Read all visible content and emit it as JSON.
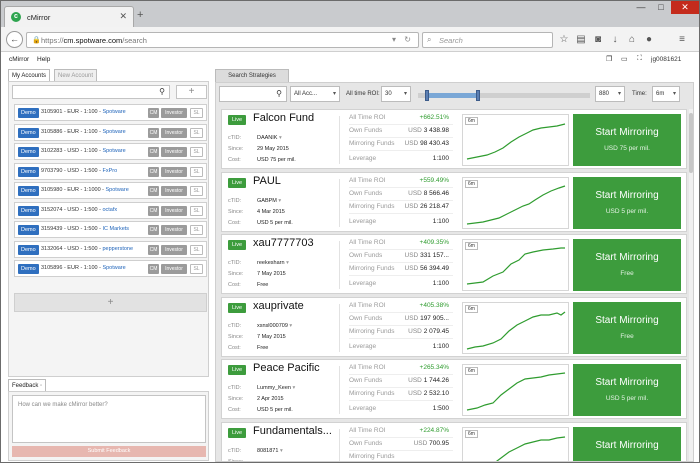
{
  "browser": {
    "tab_title": "cMirror",
    "url_scheme": "https://",
    "url_host": "cm.spotware.com",
    "url_path": "/search",
    "search_placeholder": "Search"
  },
  "appbar": {
    "menu_items": [
      "cMirror",
      "Help"
    ],
    "user": "jg0081621"
  },
  "left": {
    "tabs": [
      "My Accounts",
      "New Account"
    ],
    "add_symbol": "+",
    "accounts": [
      {
        "mode": "Demo",
        "text": "3105901 - EUR - 1:100 - ",
        "broker": "Spotware",
        "cm": "CM",
        "investor": "Investor",
        "sl": "SL"
      },
      {
        "mode": "Demo",
        "text": "3105886 - EUR - 1:100 - ",
        "broker": "Spotware",
        "cm": "CM",
        "investor": "Investor",
        "sl": "SL"
      },
      {
        "mode": "Demo",
        "text": "3102283 - USD - 1:100 - ",
        "broker": "Spotware",
        "cm": "CM",
        "investor": "Investor",
        "sl": "SL"
      },
      {
        "mode": "Demo",
        "text": "9703790 - USD - 1:500 - ",
        "broker": "FxPro",
        "cm": "CM",
        "investor": "Investor",
        "sl": "SL"
      },
      {
        "mode": "Demo",
        "text": "3105980 - EUR - 1:1000 - ",
        "broker": "Spotware",
        "cm": "CM",
        "investor": "Investor",
        "sl": "SL"
      },
      {
        "mode": "Demo",
        "text": "3152074 - USD - 1:500 - ",
        "broker": "octafx",
        "cm": "CM",
        "investor": "Investor",
        "sl": "SL"
      },
      {
        "mode": "Demo",
        "text": "3159439 - USD - 1:500 - ",
        "broker": "IC Markets",
        "cm": "CM",
        "investor": "Investor",
        "sl": "SL"
      },
      {
        "mode": "Demo",
        "text": "3132064 - USD - 1:500 - ",
        "broker": "pepperstone",
        "cm": "CM",
        "investor": "Investor",
        "sl": "SL"
      },
      {
        "mode": "Demo",
        "text": "3105896 - EUR - 1:100 - ",
        "broker": "Spotware",
        "cm": "CM",
        "investor": "Investor",
        "sl": "SL"
      }
    ],
    "feedback_tab": "Feedback",
    "feedback_placeholder": "How can we make cMirror better?",
    "feedback_button": "Submit Feedback"
  },
  "right": {
    "tab": "Search Strategies",
    "filter_account": "All Acc...",
    "roi_label": "All time ROI:",
    "roi_min": "30",
    "roi_max": "880",
    "roi_range_fraction": [
      0.05,
      0.35
    ],
    "time_label": "Time:",
    "time_value": "6m",
    "labels": {
      "ctid": "cTID:",
      "since": "Since:",
      "cost": "Cost:",
      "roi": "All Time ROI",
      "own": "Own Funds",
      "mirroring": "Mirroring Funds",
      "leverage": "Leverage",
      "live": "Live",
      "period": "6m",
      "cta": "Start Mirroring"
    },
    "strategies": [
      {
        "name": "Falcon Fund",
        "ctid": "DAANIK",
        "since": "29 May 2015",
        "cost": "USD 75 per mil.",
        "roi": "+662.51%",
        "own_cur": "USD",
        "own": "3 438.98",
        "mir_cur": "USD",
        "mir": "98 430.43",
        "leverage": "1:100",
        "cta_sub": "USD 75 per mil."
      },
      {
        "name": "PAUL",
        "ctid": "GABPM",
        "since": "4 Mar 2015",
        "cost": "USD 5 per mil.",
        "roi": "+559.49%",
        "own_cur": "USD",
        "own": "8 566.46",
        "mir_cur": "USD",
        "mir": "26 218.47",
        "leverage": "1:100",
        "cta_sub": "USD 5 per mil."
      },
      {
        "name": "xau7777703",
        "ctid": "reekesharn",
        "since": "7 May 2015",
        "cost": "Free",
        "roi": "+409.35%",
        "own_cur": "USD",
        "own": "331 157...",
        "mir_cur": "USD",
        "mir": "56 394.49",
        "leverage": "1:100",
        "cta_sub": "Free"
      },
      {
        "name": "xauprivate",
        "ctid": "xsnsl000709",
        "since": "7 May 2015",
        "cost": "Free",
        "roi": "+405.38%",
        "own_cur": "USD",
        "own": "197 905...",
        "mir_cur": "USD",
        "mir": "2 079.45",
        "leverage": "1:100",
        "cta_sub": "Free"
      },
      {
        "name": "Peace Pacific",
        "ctid": "Lummy_Keen",
        "since": "2 Apr 2015",
        "cost": "USD 5 per mil.",
        "roi": "+265.34%",
        "own_cur": "USD",
        "own": "1 744.26",
        "mir_cur": "USD",
        "mir": "2 532.10",
        "leverage": "1:500",
        "cta_sub": "USD 5 per mil."
      },
      {
        "name": "Fundamentals...",
        "ctid": "8081871",
        "since": "",
        "cost": "",
        "roi": "+224.87%",
        "own_cur": "USD",
        "own": "700.95",
        "mir_cur": "",
        "mir": "",
        "leverage": "",
        "cta_sub": ""
      }
    ]
  },
  "colors": {
    "green": "#3d9c3d",
    "blue": "#2f6fbf",
    "roi_green": "#2f9c2f"
  }
}
